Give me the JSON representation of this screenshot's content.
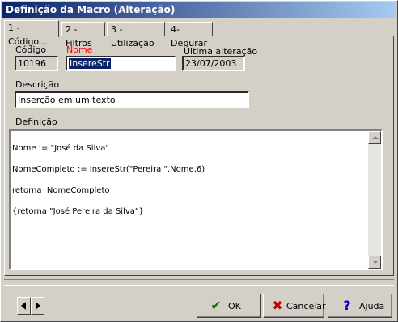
{
  "window": {
    "title": "Definição da Macro (Alteração)"
  },
  "tabs": [
    {
      "label": "1 - Código...",
      "active": true
    },
    {
      "label": "2 - Filtros"
    },
    {
      "label": "3 - Utilização"
    },
    {
      "label": "4- Depurar"
    }
  ],
  "form": {
    "codigo": {
      "label": "Código",
      "value": "10196"
    },
    "nome": {
      "label": "Nome",
      "value": "InsereStr"
    },
    "ultima": {
      "label": "Última alteração",
      "value": "23/07/2003"
    },
    "descricao": {
      "label": "Descrição",
      "value": "Inserção em um texto"
    },
    "definicao": {
      "label": "Definição"
    }
  },
  "code_lines": [
    "Nome := \"José da Silva\"",
    "NomeCompleto := InsereStr(\"Pereira \",Nome,6)",
    "retorna  NomeCompleto",
    "{retorna \"José Pereira da Silva\"}"
  ],
  "buttons": {
    "ok": "OK",
    "cancelar": "Cancelar",
    "ajuda": "Ajuda"
  },
  "colors": {
    "accent_red": "#ff0000",
    "title_start": "#0a246a",
    "ok_check": "#008000",
    "cancel_x": "#c00000",
    "help_q": "#0000c0"
  }
}
